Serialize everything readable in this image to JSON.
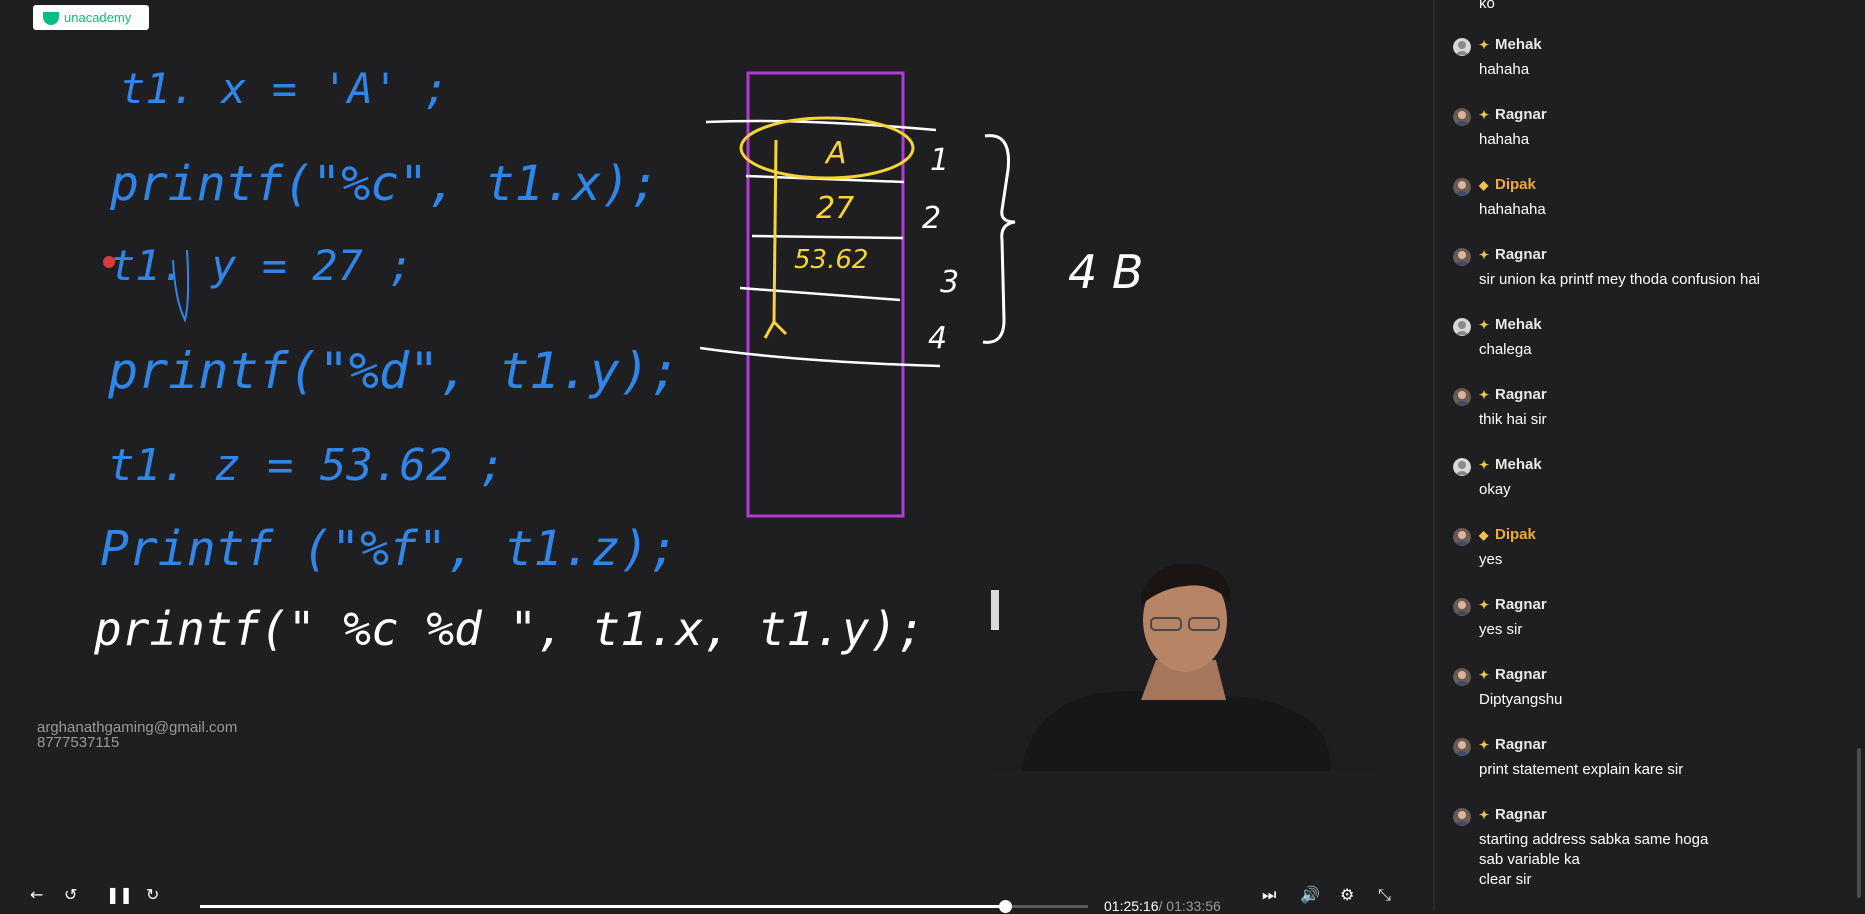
{
  "brand": {
    "name": "unacademy"
  },
  "board": {
    "lines": [
      "t1. x  =  'A' ;",
      "printf(\"%c\", t1.x);",
      "t1. y  =  27 ;",
      "printf(\"%d\", t1.y);",
      "t1. z  =  53.62 ;",
      "Printf (\"%f\",  t1.z);"
    ],
    "last_line": "printf(\" %c   %d \", t1.x, t1.y);",
    "memory_values": [
      "A",
      "27",
      "53.62"
    ],
    "slot_numbers": [
      "1",
      "2",
      "3",
      "4"
    ],
    "size_label": "4 B"
  },
  "watermark": {
    "email": "arghanathgaming@gmail.com",
    "phone": "8777537115"
  },
  "player": {
    "current_time": "01:25:16",
    "duration": "/ 01:33:56",
    "progress": 0.907
  },
  "chat": {
    "partial_top": "ko",
    "messages": [
      {
        "user": "Mehak",
        "badge": "plus",
        "text": "hahaha"
      },
      {
        "user": "Ragnar",
        "badge": "plus",
        "text": "hahaha"
      },
      {
        "user": "Dipak",
        "badge": "diamond",
        "text": "hahahaha"
      },
      {
        "user": "Ragnar",
        "badge": "plus",
        "text": "sir union ka printf mey thoda confusion hai"
      },
      {
        "user": "Mehak",
        "badge": "plus",
        "text": "chalega"
      },
      {
        "user": "Ragnar",
        "badge": "plus",
        "text": "thik hai sir"
      },
      {
        "user": "Mehak",
        "badge": "plus",
        "text": "okay"
      },
      {
        "user": "Dipak",
        "badge": "diamond",
        "text": "yes"
      },
      {
        "user": "Ragnar",
        "badge": "plus",
        "text": "yes sir"
      },
      {
        "user": "Ragnar",
        "badge": "plus",
        "text": "Diptyangshu"
      },
      {
        "user": "Ragnar",
        "badge": "plus",
        "text": "print statement explain kare sir"
      },
      {
        "user": "Ragnar",
        "badge": "plus",
        "text": "starting address sabka same hoga"
      }
    ],
    "last_extra": [
      "sab variable ka",
      "clear sir"
    ]
  }
}
